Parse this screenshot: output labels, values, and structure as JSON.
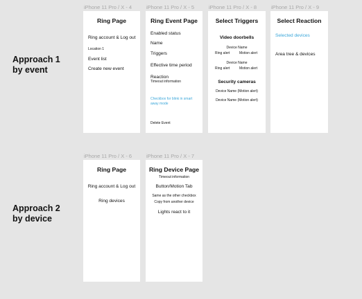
{
  "rows": [
    {
      "label_line1": "Approach 1",
      "label_line2": "by event"
    },
    {
      "label_line1": "Approach 2",
      "label_line2": "by device"
    }
  ],
  "frames": {
    "f4": {
      "label": "iPhone 11 Pro / X - 4",
      "title": "Ring Page",
      "items": [
        "Ring account & Log out",
        "Location 1",
        "Event list",
        "Create new event"
      ]
    },
    "f5": {
      "label": "iPhone 11 Pro / X - 5",
      "title": "Ring Event Page",
      "items": [
        "Enabled status",
        "Name",
        "Triggers",
        "Effective time period",
        "Reaction",
        "Timeout information"
      ],
      "checkbox_note": "Checkbox for blink in smart away mode",
      "delete_label": "Delete Event"
    },
    "f8": {
      "label": "iPhone 11 Pro / X - 8",
      "title": "Select Triggers",
      "section1": "Video doorbells",
      "device_name": "Device Name",
      "ring_alert": "Ring alert",
      "motion_alert": "Motion alert",
      "section2": "Security cameras",
      "camera_item": "Device Name (Motion alert)"
    },
    "f9": {
      "label": "iPhone 11 Pro / X - 9",
      "title": "Select Reaction",
      "selected": "Selected devices",
      "area": "Area tree & devices"
    },
    "f6": {
      "label": "iPhone 11 Pro / X - 6",
      "title": "Ring Page",
      "items": [
        "Ring account & Log out",
        "Ring devices"
      ]
    },
    "f7": {
      "label": "iPhone 11 Pro / X - 7",
      "title": "Ring Device Page",
      "timeout": "Timeout information",
      "tab": "Button/Motion Tab",
      "same": "Same as the other checkbox",
      "copy": "Copy from another device",
      "lights": "Lights react to it"
    }
  },
  "colors": {
    "background": "#e5e5e5",
    "frame": "#ffffff",
    "link": "#3aa6d9",
    "frame_label": "#a8a8a8"
  }
}
